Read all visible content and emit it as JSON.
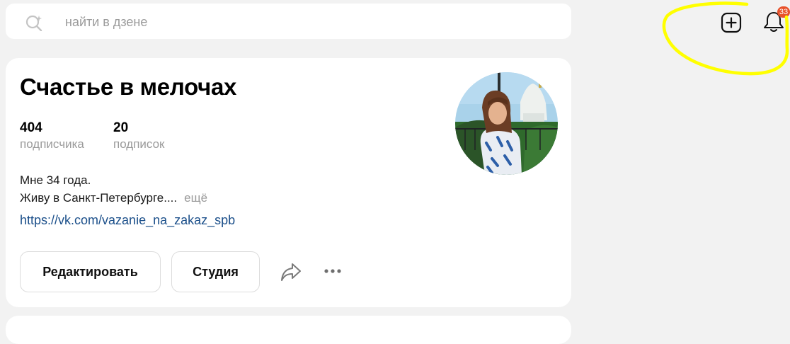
{
  "search": {
    "placeholder": "найти в дзене",
    "icon": "search-icon"
  },
  "header": {
    "add_icon": "plus-square-icon",
    "bell_icon": "bell-icon",
    "notification_count": "33",
    "badge_color": "#e8512a",
    "highlight_color": "#ffff00"
  },
  "profile": {
    "title": "Счастье в мелочах",
    "stats": {
      "subscribers_value": "404",
      "subscribers_label": "подписчика",
      "subscriptions_value": "20",
      "subscriptions_label": "подписок"
    },
    "bio_line1": "Мне 34 года.",
    "bio_line2": "Живу в Санкт-Петербурге....",
    "more_label": "ещё",
    "link": "https://vk.com/vazanie_na_zakaz_spb",
    "link_color": "#1b4f8a",
    "buttons": {
      "edit": "Редактировать",
      "studio": "Студия",
      "share_icon": "share-arrow-icon",
      "more_icon": "more-dots-icon"
    },
    "avatar_icon": "avatar-photo"
  }
}
